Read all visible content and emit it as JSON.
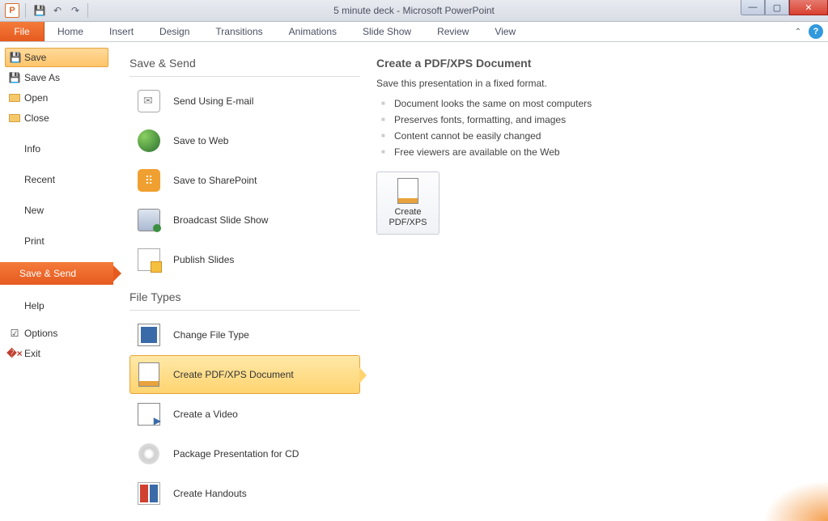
{
  "titlebar": {
    "title": "5 minute deck - Microsoft PowerPoint"
  },
  "ribbon": {
    "file": "File",
    "tabs": [
      "Home",
      "Insert",
      "Design",
      "Transitions",
      "Animations",
      "Slide Show",
      "Review",
      "View"
    ]
  },
  "backstage_left": {
    "save": "Save",
    "save_as": "Save As",
    "open": "Open",
    "close": "Close",
    "info": "Info",
    "recent": "Recent",
    "new": "New",
    "print": "Print",
    "save_send": "Save & Send",
    "help": "Help",
    "options": "Options",
    "exit": "Exit"
  },
  "mid": {
    "section1": "Save & Send",
    "items1": [
      {
        "label": "Send Using E-mail"
      },
      {
        "label": "Save to Web"
      },
      {
        "label": "Save to SharePoint"
      },
      {
        "label": "Broadcast Slide Show"
      },
      {
        "label": "Publish Slides"
      }
    ],
    "section2": "File Types",
    "items2": [
      {
        "label": "Change File Type"
      },
      {
        "label": "Create PDF/XPS Document"
      },
      {
        "label": "Create a Video"
      },
      {
        "label": "Package Presentation for CD"
      },
      {
        "label": "Create Handouts"
      }
    ]
  },
  "right": {
    "title": "Create a PDF/XPS Document",
    "subtitle": "Save this presentation in a fixed format.",
    "bullets": [
      "Document looks the same on most computers",
      "Preserves fonts, formatting, and images",
      "Content cannot be easily changed",
      "Free viewers are available on the Web"
    ],
    "button_line1": "Create",
    "button_line2": "PDF/XPS"
  }
}
